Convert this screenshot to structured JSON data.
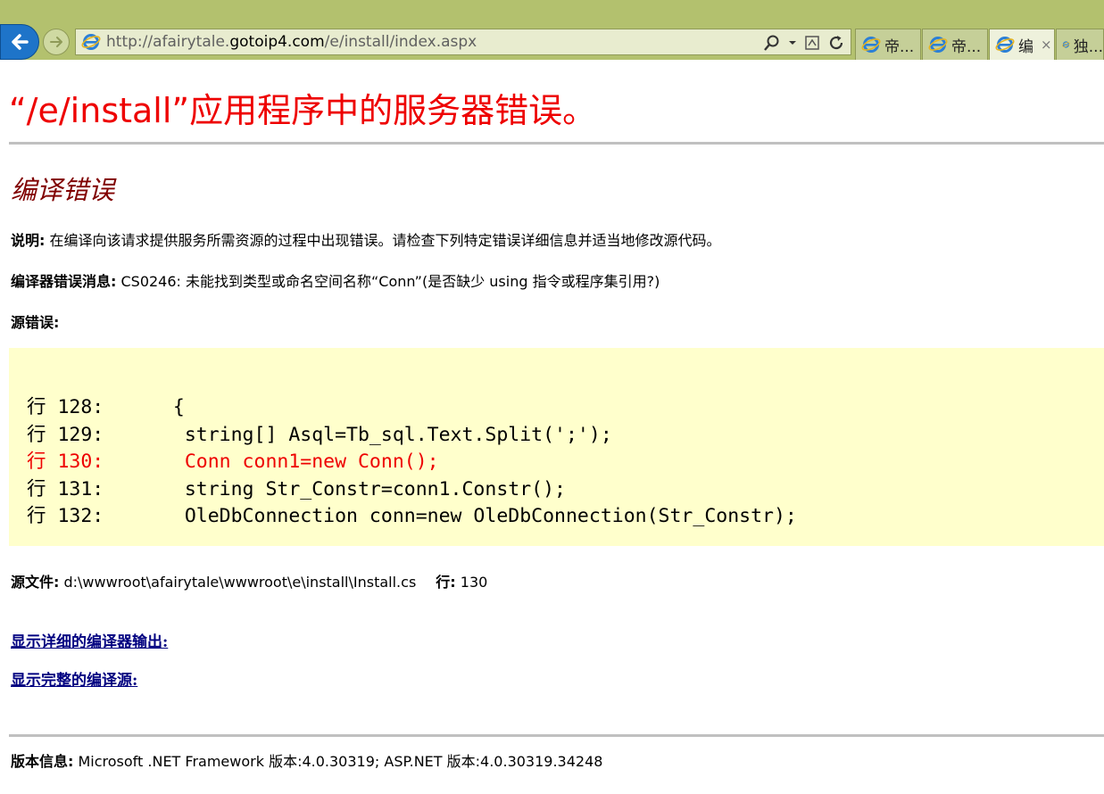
{
  "browser": {
    "url_prefix": "http://afairytale.",
    "url_host": "gotoip4.com",
    "url_suffix": "/e/install/index.aspx",
    "tabs": [
      {
        "label": "帝..."
      },
      {
        "label": "帝..."
      },
      {
        "label": "编",
        "close": "×"
      },
      {
        "label": "独..."
      }
    ]
  },
  "page": {
    "title": "“/e/install”应用程序中的服务器错误。",
    "section_title": "编译错误",
    "description_label": "说明:",
    "description_text": " 在编译向该请求提供服务所需资源的过程中出现错误。请检查下列特定错误详细信息并适当地修改源代码。",
    "compiler_msg_label": "编译器错误消息:",
    "compiler_msg_text": " CS0246: 未能找到类型或命名空间名称“Conn”(是否缺少 using 指令或程序集引用?)",
    "source_error_label": "源错误:",
    "code_lines": [
      {
        "text": "行 128:      {"
      },
      {
        "text": "行 129:       string[] Asql=Tb_sql.Text.Split(';');"
      },
      {
        "text": "行 130:       Conn conn1=new Conn();"
      },
      {
        "text": "行 131:       string Str_Constr=conn1.Constr();"
      },
      {
        "text": "行 132:       OleDbConnection conn=new OleDbConnection(Str_Constr);"
      }
    ],
    "source_file_label": "源文件:",
    "source_file_path": " d:\\wwwroot\\afairytale\\wwwroot\\e\\install\\Install.cs",
    "line_label": "行:",
    "line_number": " 130",
    "link_compiler_output": "显示详细的编译器输出:",
    "link_full_source": "显示完整的编译源:",
    "version_label": "版本信息:",
    "version_text": " Microsoft .NET Framework 版本:4.0.30319; ASP.NET 版本:4.0.30319.34248"
  },
  "colors": {
    "chrome_bg": "#b3c16e",
    "title_red": "#ee0000",
    "section_maroon": "#800000",
    "code_bg": "#ffffcc",
    "link_navy": "#000080"
  },
  "icons": [
    "back-arrow-icon",
    "forward-arrow-icon",
    "ie-icon",
    "search-icon",
    "chevron-down-icon",
    "compatibility-icon",
    "refresh-icon",
    "close-icon"
  ]
}
